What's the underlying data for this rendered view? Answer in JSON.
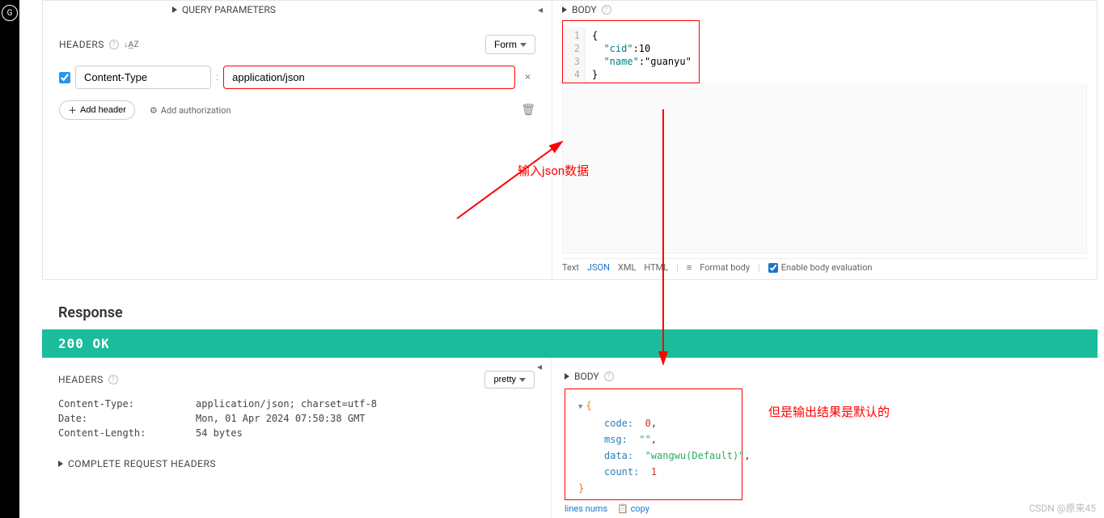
{
  "request": {
    "query_params_label": "QUERY PARAMETERS",
    "headers_label": "HEADERS",
    "form_button": "Form",
    "header_kv": {
      "key": "Content-Type",
      "value": "application/json"
    },
    "add_header": "Add header",
    "add_auth": "Add authorization",
    "body_label": "BODY",
    "body_code": {
      "lines": [
        "1",
        "2",
        "3",
        "4"
      ],
      "l1": "{",
      "l2_k": "\"cid\"",
      "l2_v": ":10",
      "l3_k": "\"name\"",
      "l3_v": ":\"guanyu\"",
      "l4": "}"
    },
    "fmt": {
      "text": "Text",
      "json": "JSON",
      "xml": "XML",
      "html": "HTML",
      "format_body": "Format body",
      "enable_eval": "Enable body evaluation"
    }
  },
  "response": {
    "title": "Response",
    "status": "200  OK",
    "headers_label": "HEADERS",
    "pretty": "pretty",
    "headers": [
      {
        "k": "Content-Type:",
        "v": "application/json; charset=utf-8"
      },
      {
        "k": "Date:",
        "v": "Mon, 01 Apr 2024 07:50:38 GMT"
      },
      {
        "k": "Content-Length:",
        "v": "54 bytes"
      }
    ],
    "complete_label": "COMPLETE REQUEST HEADERS",
    "body_label": "BODY",
    "json": {
      "open": "{",
      "code_k": "code:",
      "code_v": "0",
      "comma": ",",
      "msg_k": "msg:",
      "msg_v": "\"\"",
      "data_k": "data:",
      "data_v": "\"wangwu(Default)\"",
      "count_k": "count:",
      "count_v": "1",
      "close": "}"
    },
    "links": {
      "lines": "lines nums",
      "copy": "copy"
    }
  },
  "annotations": {
    "input_json": "输入json数据",
    "output_default": "但是输出结果是默认的"
  },
  "watermark": "CSDN @原来45"
}
